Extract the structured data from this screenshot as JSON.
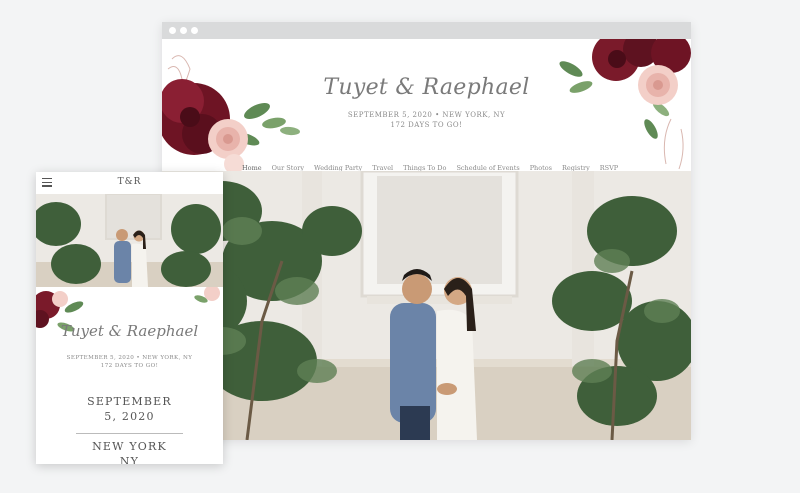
{
  "desktop": {
    "title": "Tuyet & Raephael",
    "date_location": "SEPTEMBER 5, 2020 • NEW YORK, NY",
    "countdown": "172 DAYS TO GO!",
    "nav": [
      "Home",
      "Our Story",
      "Wedding Party",
      "Travel",
      "Things To Do",
      "Schedule of Events",
      "Photos",
      "Registry",
      "RSVP"
    ],
    "active_nav": "Home"
  },
  "mobile": {
    "monogram": "T&R",
    "title": "Tuyet & Raephael",
    "date_location": "SEPTEMBER 5, 2020 • NEW YORK, NY",
    "countdown": "172 DAYS TO GO!",
    "date_line1": "SEPTEMBER",
    "date_line2": "5, 2020",
    "location_line1": "NEW YORK",
    "location_line2": "NY"
  },
  "colors": {
    "background": "#f3f4f5",
    "burgundy": "#7a1a2a",
    "blush": "#f1c9c4",
    "leaf": "#5f8a55"
  },
  "icons": [
    "menu-icon",
    "window-dot-icon"
  ]
}
